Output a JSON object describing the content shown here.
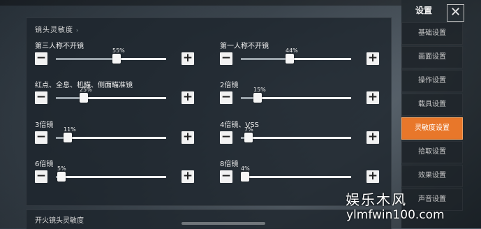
{
  "header": {
    "section_title": "镜头灵敏度",
    "bottom_section_title": "开火镜头灵敏度"
  },
  "settings": [
    {
      "label": "第三人称不开镜",
      "value": "55%",
      "percent": 55
    },
    {
      "label": "第一人称不开镜",
      "value": "44%",
      "percent": 44
    },
    {
      "label": "红点、全息、机瞄、侧面瞄准镜",
      "value": "25%",
      "percent": 25
    },
    {
      "label": "2倍镜",
      "value": "15%",
      "percent": 15
    },
    {
      "label": "3倍镜",
      "value": "11%",
      "percent": 11
    },
    {
      "label": "4倍镜、VSS",
      "value": "7%",
      "percent": 7
    },
    {
      "label": "6倍镜",
      "value": "5%",
      "percent": 5
    },
    {
      "label": "8倍镜",
      "value": "4%",
      "percent": 4
    }
  ],
  "buttons": {
    "minus": "−",
    "plus": "+"
  },
  "sidebar": {
    "title": "设置",
    "close": "✕",
    "items": [
      {
        "label": "基础设置"
      },
      {
        "label": "画面设置"
      },
      {
        "label": "操作设置"
      },
      {
        "label": "载具设置"
      },
      {
        "label": "灵敏度设置",
        "active": true
      },
      {
        "label": "拾取设置"
      },
      {
        "label": "效果设置"
      },
      {
        "label": "声音设置"
      }
    ]
  },
  "watermark": {
    "name": "娱乐木风",
    "url": "ylmfwin100.com"
  },
  "colors": {
    "accent": "#e8772a"
  }
}
